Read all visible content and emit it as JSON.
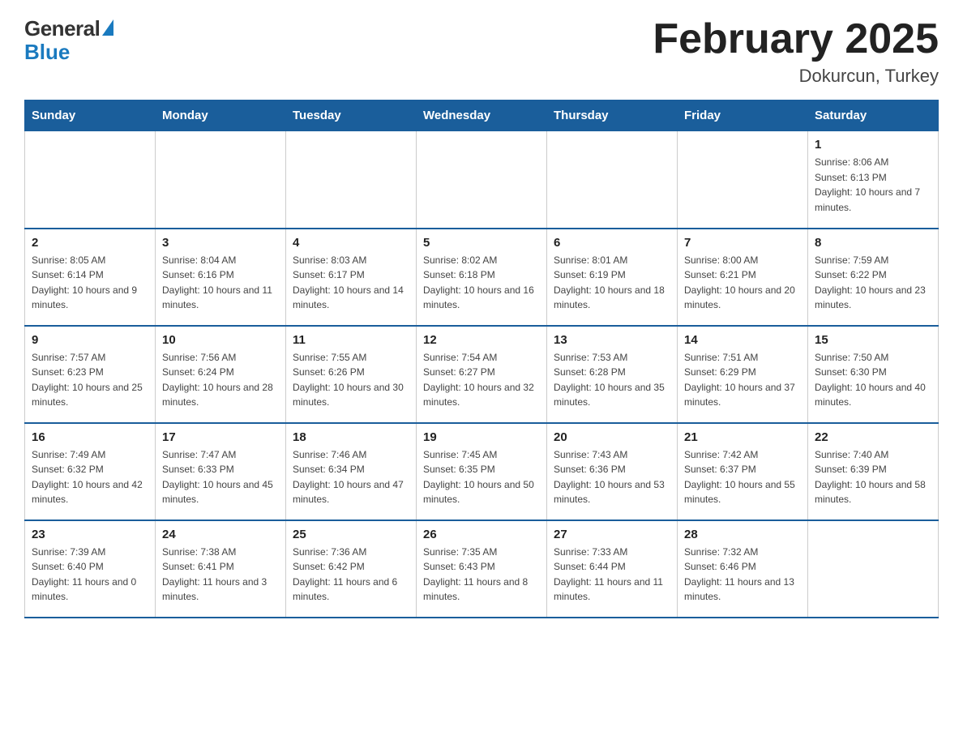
{
  "header": {
    "logo_general": "General",
    "logo_blue": "Blue",
    "month_title": "February 2025",
    "location": "Dokurcun, Turkey"
  },
  "days_of_week": [
    "Sunday",
    "Monday",
    "Tuesday",
    "Wednesday",
    "Thursday",
    "Friday",
    "Saturday"
  ],
  "weeks": [
    [
      {
        "day": "",
        "sunrise": "",
        "sunset": "",
        "daylight": ""
      },
      {
        "day": "",
        "sunrise": "",
        "sunset": "",
        "daylight": ""
      },
      {
        "day": "",
        "sunrise": "",
        "sunset": "",
        "daylight": ""
      },
      {
        "day": "",
        "sunrise": "",
        "sunset": "",
        "daylight": ""
      },
      {
        "day": "",
        "sunrise": "",
        "sunset": "",
        "daylight": ""
      },
      {
        "day": "",
        "sunrise": "",
        "sunset": "",
        "daylight": ""
      },
      {
        "day": "1",
        "sunrise": "Sunrise: 8:06 AM",
        "sunset": "Sunset: 6:13 PM",
        "daylight": "Daylight: 10 hours and 7 minutes."
      }
    ],
    [
      {
        "day": "2",
        "sunrise": "Sunrise: 8:05 AM",
        "sunset": "Sunset: 6:14 PM",
        "daylight": "Daylight: 10 hours and 9 minutes."
      },
      {
        "day": "3",
        "sunrise": "Sunrise: 8:04 AM",
        "sunset": "Sunset: 6:16 PM",
        "daylight": "Daylight: 10 hours and 11 minutes."
      },
      {
        "day": "4",
        "sunrise": "Sunrise: 8:03 AM",
        "sunset": "Sunset: 6:17 PM",
        "daylight": "Daylight: 10 hours and 14 minutes."
      },
      {
        "day": "5",
        "sunrise": "Sunrise: 8:02 AM",
        "sunset": "Sunset: 6:18 PM",
        "daylight": "Daylight: 10 hours and 16 minutes."
      },
      {
        "day": "6",
        "sunrise": "Sunrise: 8:01 AM",
        "sunset": "Sunset: 6:19 PM",
        "daylight": "Daylight: 10 hours and 18 minutes."
      },
      {
        "day": "7",
        "sunrise": "Sunrise: 8:00 AM",
        "sunset": "Sunset: 6:21 PM",
        "daylight": "Daylight: 10 hours and 20 minutes."
      },
      {
        "day": "8",
        "sunrise": "Sunrise: 7:59 AM",
        "sunset": "Sunset: 6:22 PM",
        "daylight": "Daylight: 10 hours and 23 minutes."
      }
    ],
    [
      {
        "day": "9",
        "sunrise": "Sunrise: 7:57 AM",
        "sunset": "Sunset: 6:23 PM",
        "daylight": "Daylight: 10 hours and 25 minutes."
      },
      {
        "day": "10",
        "sunrise": "Sunrise: 7:56 AM",
        "sunset": "Sunset: 6:24 PM",
        "daylight": "Daylight: 10 hours and 28 minutes."
      },
      {
        "day": "11",
        "sunrise": "Sunrise: 7:55 AM",
        "sunset": "Sunset: 6:26 PM",
        "daylight": "Daylight: 10 hours and 30 minutes."
      },
      {
        "day": "12",
        "sunrise": "Sunrise: 7:54 AM",
        "sunset": "Sunset: 6:27 PM",
        "daylight": "Daylight: 10 hours and 32 minutes."
      },
      {
        "day": "13",
        "sunrise": "Sunrise: 7:53 AM",
        "sunset": "Sunset: 6:28 PM",
        "daylight": "Daylight: 10 hours and 35 minutes."
      },
      {
        "day": "14",
        "sunrise": "Sunrise: 7:51 AM",
        "sunset": "Sunset: 6:29 PM",
        "daylight": "Daylight: 10 hours and 37 minutes."
      },
      {
        "day": "15",
        "sunrise": "Sunrise: 7:50 AM",
        "sunset": "Sunset: 6:30 PM",
        "daylight": "Daylight: 10 hours and 40 minutes."
      }
    ],
    [
      {
        "day": "16",
        "sunrise": "Sunrise: 7:49 AM",
        "sunset": "Sunset: 6:32 PM",
        "daylight": "Daylight: 10 hours and 42 minutes."
      },
      {
        "day": "17",
        "sunrise": "Sunrise: 7:47 AM",
        "sunset": "Sunset: 6:33 PM",
        "daylight": "Daylight: 10 hours and 45 minutes."
      },
      {
        "day": "18",
        "sunrise": "Sunrise: 7:46 AM",
        "sunset": "Sunset: 6:34 PM",
        "daylight": "Daylight: 10 hours and 47 minutes."
      },
      {
        "day": "19",
        "sunrise": "Sunrise: 7:45 AM",
        "sunset": "Sunset: 6:35 PM",
        "daylight": "Daylight: 10 hours and 50 minutes."
      },
      {
        "day": "20",
        "sunrise": "Sunrise: 7:43 AM",
        "sunset": "Sunset: 6:36 PM",
        "daylight": "Daylight: 10 hours and 53 minutes."
      },
      {
        "day": "21",
        "sunrise": "Sunrise: 7:42 AM",
        "sunset": "Sunset: 6:37 PM",
        "daylight": "Daylight: 10 hours and 55 minutes."
      },
      {
        "day": "22",
        "sunrise": "Sunrise: 7:40 AM",
        "sunset": "Sunset: 6:39 PM",
        "daylight": "Daylight: 10 hours and 58 minutes."
      }
    ],
    [
      {
        "day": "23",
        "sunrise": "Sunrise: 7:39 AM",
        "sunset": "Sunset: 6:40 PM",
        "daylight": "Daylight: 11 hours and 0 minutes."
      },
      {
        "day": "24",
        "sunrise": "Sunrise: 7:38 AM",
        "sunset": "Sunset: 6:41 PM",
        "daylight": "Daylight: 11 hours and 3 minutes."
      },
      {
        "day": "25",
        "sunrise": "Sunrise: 7:36 AM",
        "sunset": "Sunset: 6:42 PM",
        "daylight": "Daylight: 11 hours and 6 minutes."
      },
      {
        "day": "26",
        "sunrise": "Sunrise: 7:35 AM",
        "sunset": "Sunset: 6:43 PM",
        "daylight": "Daylight: 11 hours and 8 minutes."
      },
      {
        "day": "27",
        "sunrise": "Sunrise: 7:33 AM",
        "sunset": "Sunset: 6:44 PM",
        "daylight": "Daylight: 11 hours and 11 minutes."
      },
      {
        "day": "28",
        "sunrise": "Sunrise: 7:32 AM",
        "sunset": "Sunset: 6:46 PM",
        "daylight": "Daylight: 11 hours and 13 minutes."
      },
      {
        "day": "",
        "sunrise": "",
        "sunset": "",
        "daylight": ""
      }
    ]
  ]
}
